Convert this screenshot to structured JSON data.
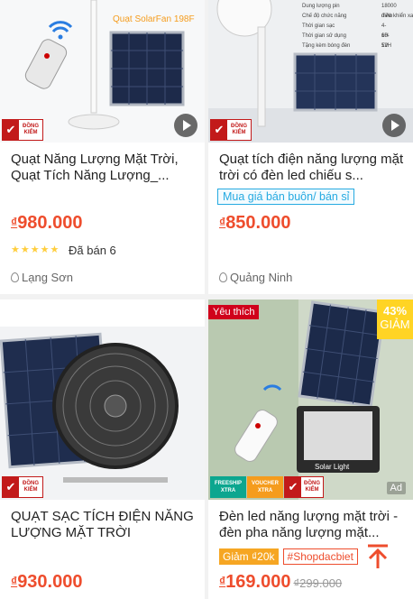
{
  "products": [
    {
      "title": "Quạt Năng Lượng Mặt Trời, Quạt Tích Năng Lượng_...",
      "image_caption": "Quạt SolarFan 198F",
      "badge": "ĐỒNG KIỂM",
      "currency": "₫",
      "price": "980.000",
      "rating_stars": 5,
      "sold": "Đã bán 6",
      "location": "Lạng Sơn"
    },
    {
      "title": "Quạt tích điện năng lượng mặt trời có đèn led chiếu s...",
      "badge": "ĐỒNG KIỂM",
      "wholesale_label": "Mua giá bán buôn/ bán sỉ",
      "currency": "₫",
      "price": "850.000",
      "location": "Quảng Ninh",
      "spec_labels": [
        "Dung lượng pin",
        "Chế độ chức năng",
        "Thời gian sạc",
        "Thời gian sử dụng",
        "Tặng kèm bóng đèn"
      ],
      "spec_values": [
        "18000 mAh",
        "điều khiển xa, bằng tay",
        "4-6H",
        "10-12H",
        "5V"
      ]
    },
    {
      "title": "QUẠT SẠC TÍCH ĐIỆN NĂNG LƯỢNG MẶT TRỜI",
      "badge": "ĐỒNG KIỂM",
      "currency": "₫",
      "price": "930.000"
    },
    {
      "title": "Đèn led năng lượng mặt trời - đèn pha năng lượng mặt...",
      "favorite_label": "Yêu thích",
      "discount_percent": "43%",
      "discount_label": "GIẢM",
      "badges": [
        "FREESHIP XTRA",
        "VOUCHER XTRA",
        "ĐỒNG KIỂM"
      ],
      "ad_label": "Ad",
      "lamp_text": "Solar Light",
      "chip_discount": "Giảm ₫20k",
      "chip_hashtag": "#Shopdacbiet",
      "currency": "₫",
      "price": "169.000",
      "old_price": "₫299.000"
    }
  ],
  "colors": {
    "accent": "#ee4d2d",
    "badge_red": "#c21a1a",
    "wholesale_blue": "#26aae1"
  }
}
